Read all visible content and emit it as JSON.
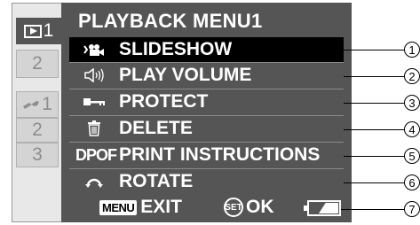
{
  "menu": {
    "title": "PLAYBACK MENU1",
    "tabs": [
      {
        "icon": "playback-icon",
        "number": "1",
        "active": true
      },
      {
        "label": "2",
        "active": false
      },
      {
        "icon": "setup-wrench-icon",
        "number": "1",
        "active": false
      },
      {
        "label": "2",
        "active": false
      },
      {
        "label": "3",
        "active": false
      }
    ],
    "items": [
      {
        "label": "SLIDESHOW",
        "icon": "slideshow-icon",
        "selected": true
      },
      {
        "label": "PLAY VOLUME",
        "icon": "speaker-volume-icon",
        "selected": false
      },
      {
        "label": "PROTECT",
        "icon": "key-protect-icon",
        "selected": false
      },
      {
        "label": "DELETE",
        "icon": "trash-icon",
        "selected": false
      },
      {
        "label": "PRINT INSTRUCTIONS",
        "icon": "dpof-icon",
        "icon_text": "DPOF",
        "selected": false
      },
      {
        "label": "ROTATE",
        "icon": "rotate-icon",
        "selected": false
      }
    ],
    "footer": {
      "menu_key": "MENU",
      "exit_label": "EXIT",
      "set_key": "SET",
      "ok_label": "OK",
      "battery": "battery-icon"
    }
  },
  "callouts": [
    "1",
    "2",
    "3",
    "4",
    "5",
    "6",
    "7"
  ],
  "colors": {
    "panel": "#555555",
    "selected_row": "#000000",
    "text": "#ffffff",
    "tab_inactive": "#d4d4d4"
  }
}
